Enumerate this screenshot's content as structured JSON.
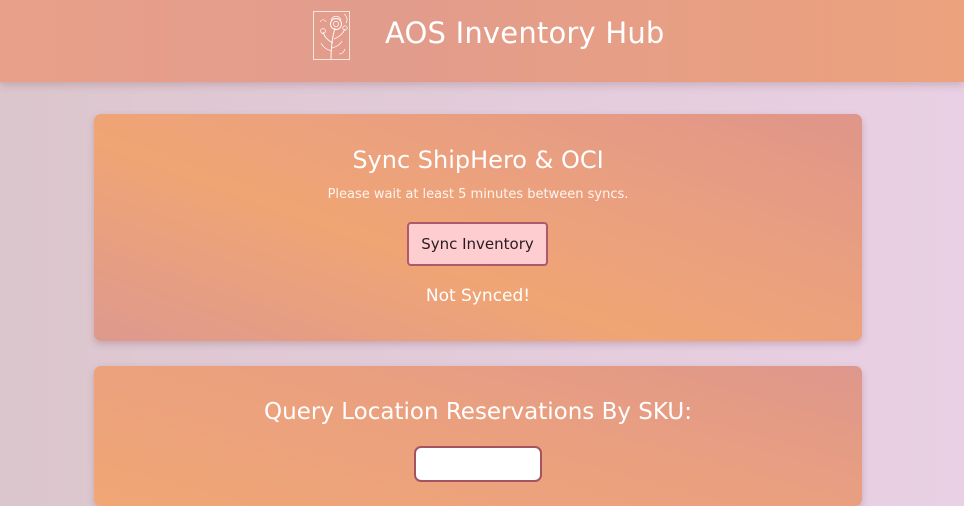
{
  "header": {
    "title": "AOS Inventory Hub",
    "logo_icon": "flower-bouquet-logo-icon"
  },
  "sync_card": {
    "title": "Sync ShipHero & OCI",
    "note": "Please wait at least 5 minutes between syncs.",
    "button_label": "Sync Inventory",
    "status": "Not Synced!"
  },
  "query_card": {
    "title": "Query Location Reservations By SKU:",
    "sku_input_value": "",
    "sku_input_placeholder": ""
  },
  "colors": {
    "header_accent": "#e8a08a",
    "card_accent": "#f0a574",
    "button_fill": "#fdcdd0",
    "button_border": "#b0596a",
    "page_background": "#e2cbd9"
  }
}
